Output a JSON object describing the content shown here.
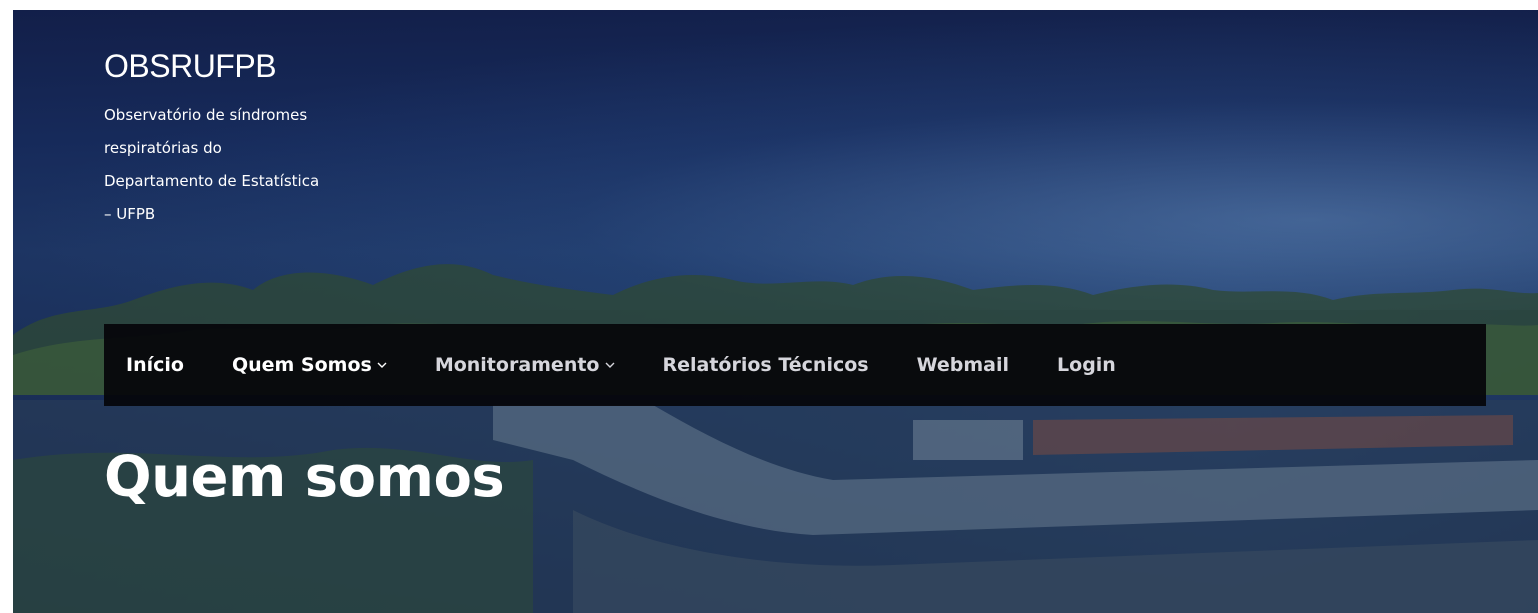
{
  "site": {
    "title": "OBSRUFPB",
    "tagline_lines": [
      "Observatório de síndromes",
      "respiratórias do",
      "Departamento de Estatística",
      "– UFPB"
    ]
  },
  "nav": {
    "items": [
      {
        "label": "Início",
        "has_dropdown": false,
        "icon": ""
      },
      {
        "label": "Quem Somos",
        "has_dropdown": true,
        "icon": "chevron-down-icon"
      },
      {
        "label": "Monitoramento",
        "has_dropdown": true,
        "icon": "chevron-down-icon"
      },
      {
        "label": "Relatórios Técnicos",
        "has_dropdown": false,
        "icon": ""
      },
      {
        "label": "Webmail",
        "has_dropdown": false,
        "icon": ""
      },
      {
        "label": "Login",
        "has_dropdown": false,
        "icon": ""
      }
    ]
  },
  "page": {
    "heading": "Quem somos"
  },
  "colors": {
    "navbar_bg": "#05050a",
    "text": "#ffffff",
    "nav_muted": "#d6d6dc",
    "hero_overlay": "#1a2c5e"
  }
}
